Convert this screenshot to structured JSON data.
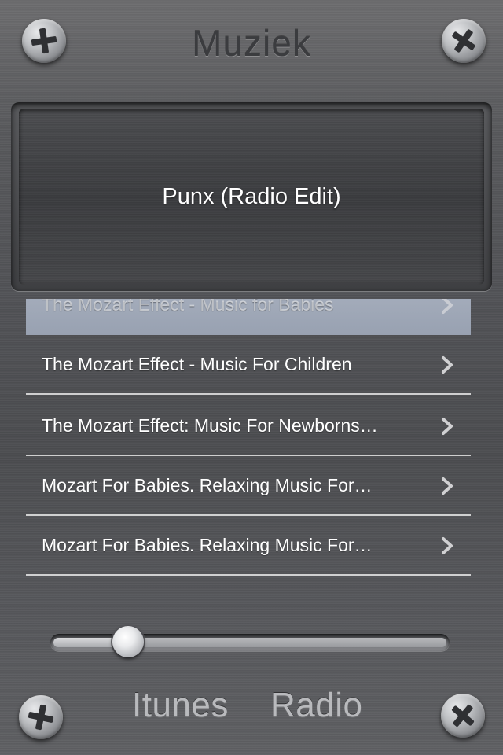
{
  "app": {
    "title": "Muziek"
  },
  "display": {
    "now_playing": "Punx (Radio Edit)"
  },
  "list": {
    "items": [
      {
        "label": "The Mozart Effect - Music for Babies",
        "selected": true
      },
      {
        "label": "The Mozart Effect - Music For Children"
      },
      {
        "label": "The Mozart Effect: Music For Newborns…"
      },
      {
        "label": "Mozart For Babies. Relaxing Music For…"
      },
      {
        "label": "Mozart For Babies. Relaxing Music For…"
      }
    ]
  },
  "slider": {
    "value": 0.19
  },
  "tabs": {
    "itunes": "Itunes",
    "radio": "Radio"
  },
  "colors": {
    "selection": "#9fa8b8",
    "text": "#ffffff",
    "title": "#3b3c3f",
    "tab_text": "#b9babd"
  },
  "icons": {
    "screws": [
      "screw-icon",
      "screw-icon",
      "screw-icon",
      "screw-icon"
    ],
    "chevron": "chevron-right-icon"
  }
}
